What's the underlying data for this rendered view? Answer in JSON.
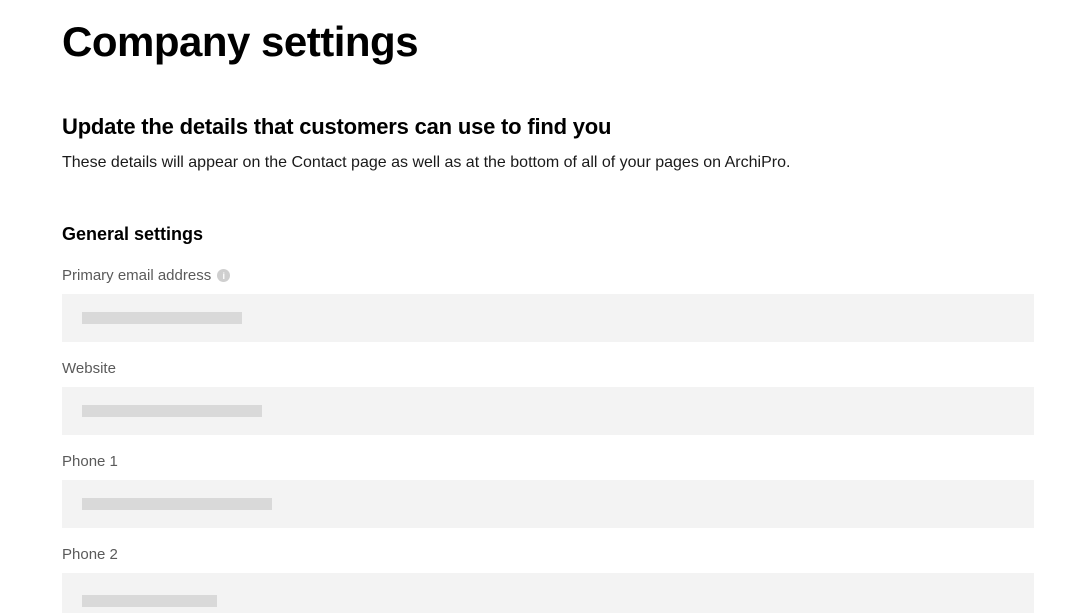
{
  "page": {
    "title": "Company settings",
    "subtitle": "Update the details that customers can use to find you",
    "description": "These details will appear on the Contact page as well as at the bottom of all of your pages on ArchiPro."
  },
  "general": {
    "heading": "General settings",
    "fields": {
      "email": {
        "label": "Primary email address",
        "value": ""
      },
      "website": {
        "label": "Website",
        "value": ""
      },
      "phone1": {
        "label": "Phone 1",
        "value": ""
      },
      "phone2": {
        "label": "Phone 2",
        "value": ""
      }
    }
  }
}
